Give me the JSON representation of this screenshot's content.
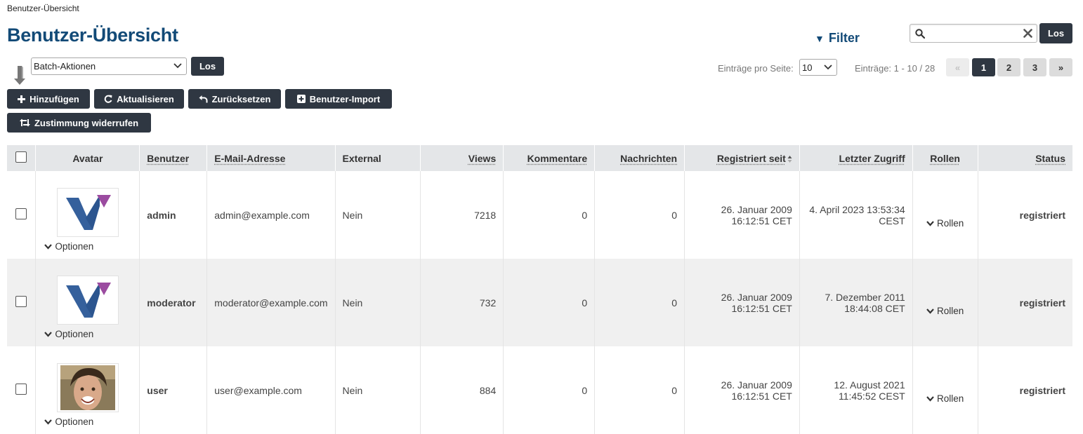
{
  "breadcrumb": "Benutzer-Übersicht",
  "title": "Benutzer-Übersicht",
  "filter": {
    "label": "Filter"
  },
  "search": {
    "value": "",
    "placeholder": "",
    "go_label": "Los"
  },
  "batch": {
    "selected": "Batch-Aktionen",
    "go_label": "Los"
  },
  "pagination": {
    "per_page_label": "Einträge pro Seite:",
    "per_page_value": "10",
    "entries_info": "Einträge: 1 - 10 / 28",
    "prev": "«",
    "pages": [
      "1",
      "2",
      "3"
    ],
    "next": "»",
    "current_page": "1"
  },
  "actions": {
    "add": "Hinzufügen",
    "refresh": "Aktualisieren",
    "reset": "Zurücksetzen",
    "import": "Benutzer-Import",
    "revoke_consent": "Zustimmung widerrufen"
  },
  "table": {
    "headers": {
      "avatar": "Avatar",
      "user": "Benutzer",
      "email": "E-Mail-Adresse",
      "external": "External",
      "views": "Views",
      "comments": "Kommentare",
      "messages": "Nachrichten",
      "registered": "Registriert seit",
      "last_access": "Letzter Zugriff",
      "roles": "Rollen",
      "status": "Status"
    },
    "options_label": "Optionen",
    "roles_label": "Rollen",
    "rows": [
      {
        "user": "admin",
        "email": "admin@example.com",
        "external": "Nein",
        "views": "7218",
        "comments": "0",
        "messages": "0",
        "registered_date": "26. Januar 2009",
        "registered_time": "16:12:51 CET",
        "last_access_line1": "4. April 2023 13:53:34",
        "last_access_line2": "CEST",
        "status": "registriert",
        "avatar": "logo"
      },
      {
        "user": "moderator",
        "email": "moderator@example.com",
        "external": "Nein",
        "views": "732",
        "comments": "0",
        "messages": "0",
        "registered_date": "26. Januar 2009",
        "registered_time": "16:12:51 CET",
        "last_access_line1": "7. Dezember 2011",
        "last_access_line2": "18:44:08 CET",
        "status": "registriert",
        "avatar": "logo"
      },
      {
        "user": "user",
        "email": "user@example.com",
        "external": "Nein",
        "views": "884",
        "comments": "0",
        "messages": "0",
        "registered_date": "26. Januar 2009",
        "registered_time": "16:12:51 CET",
        "last_access_line1": "12. August 2021",
        "last_access_line2": "11:45:52 CEST",
        "status": "registriert",
        "avatar": "photo"
      }
    ]
  },
  "colors": {
    "title": "#124a77",
    "button_dark": "#2f3742",
    "status_green": "#4a7a12",
    "header_bg": "#e4e6e8",
    "row_alt_bg": "#f0f0f0"
  }
}
